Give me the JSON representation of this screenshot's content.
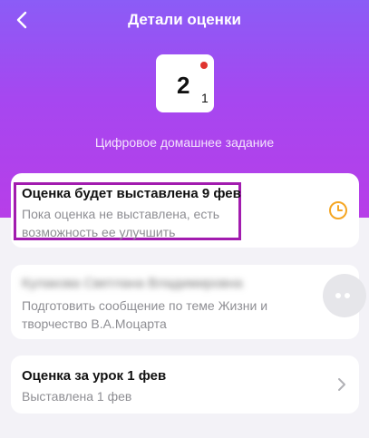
{
  "header": {
    "title": "Детали оценки"
  },
  "grade": {
    "value": "2",
    "weight": "1"
  },
  "assignment_type": "Цифровое домашнее задание",
  "status_card": {
    "title": "Оценка будет выставлена 9 фев",
    "line1": "Пока оценка не выставлена, есть",
    "line2": "возможность ее улучшить"
  },
  "comment_card": {
    "author_blurred": "Кулакова Светлана Владимировна",
    "line1": "Подготовить сообщение по теме Жизни и",
    "line2": "творчество В.А.Моцарта"
  },
  "lesson_card": {
    "title": "Оценка за урок 1 фев",
    "subtitle": "Выставлена 1 фев"
  },
  "colors": {
    "accent": "#f5a623",
    "highlight": "#a21caf"
  }
}
